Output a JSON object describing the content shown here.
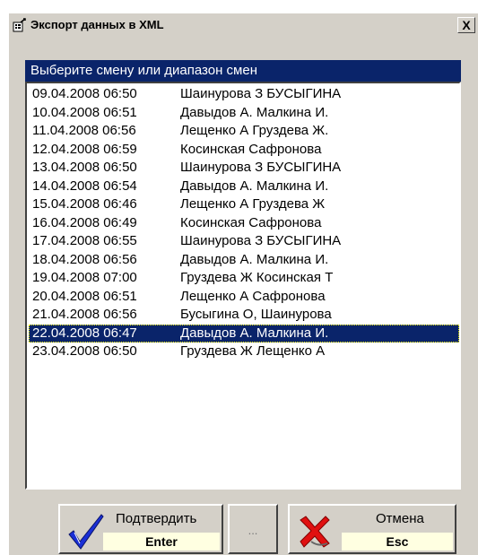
{
  "window": {
    "title": "Экспорт данных в XML",
    "close_label": "X"
  },
  "list": {
    "header": "Выберите смену или диапазон смен",
    "selected_index": 13,
    "items": [
      {
        "datetime": "09.04.2008 06:50",
        "names": "Шаинурова З БУСЫГИНА"
      },
      {
        "datetime": "10.04.2008 06:51",
        "names": "Давыдов А. Малкина И."
      },
      {
        "datetime": "11.04.2008 06:56",
        "names": "Лещенко А Груздева Ж."
      },
      {
        "datetime": "12.04.2008 06:59",
        "names": "Косинская Сафронова"
      },
      {
        "datetime": "13.04.2008 06:50",
        "names": "Шаинурова З БУСЫГИНА"
      },
      {
        "datetime": "14.04.2008 06:54",
        "names": "Давыдов А. Малкина И."
      },
      {
        "datetime": "15.04.2008 06:46",
        "names": "Лещенко А Груздева Ж"
      },
      {
        "datetime": "16.04.2008 06:49",
        "names": "Косинская Сафронова"
      },
      {
        "datetime": "17.04.2008 06:55",
        "names": "Шаинурова З БУСЫГИНА"
      },
      {
        "datetime": "18.04.2008 06:56",
        "names": "Давыдов А. Малкина И."
      },
      {
        "datetime": "19.04.2008 07:00",
        "names": "Груздева Ж Косинская Т"
      },
      {
        "datetime": "20.04.2008 06:51",
        "names": "Лещенко А Сафронова"
      },
      {
        "datetime": "21.04.2008 06:56",
        "names": "Бусыгина О, Шаинурова"
      },
      {
        "datetime": "22.04.2008 06:47",
        "names": "Давыдов А. Малкина И."
      },
      {
        "datetime": "23.04.2008 06:50",
        "names": "Груздева Ж Лещенко А"
      }
    ]
  },
  "buttons": {
    "confirm": {
      "label": "Подтвердить",
      "key": "Enter",
      "icon": "checkmark-icon"
    },
    "dots": {
      "label": "..."
    },
    "cancel": {
      "label": "Отмена",
      "key": "Esc",
      "icon": "red-x-icon"
    }
  },
  "colors": {
    "header_bg": "#0a246a",
    "selection_bg": "#0a246a",
    "key_bg": "#ffffe1",
    "face": "#d4d0c8"
  }
}
